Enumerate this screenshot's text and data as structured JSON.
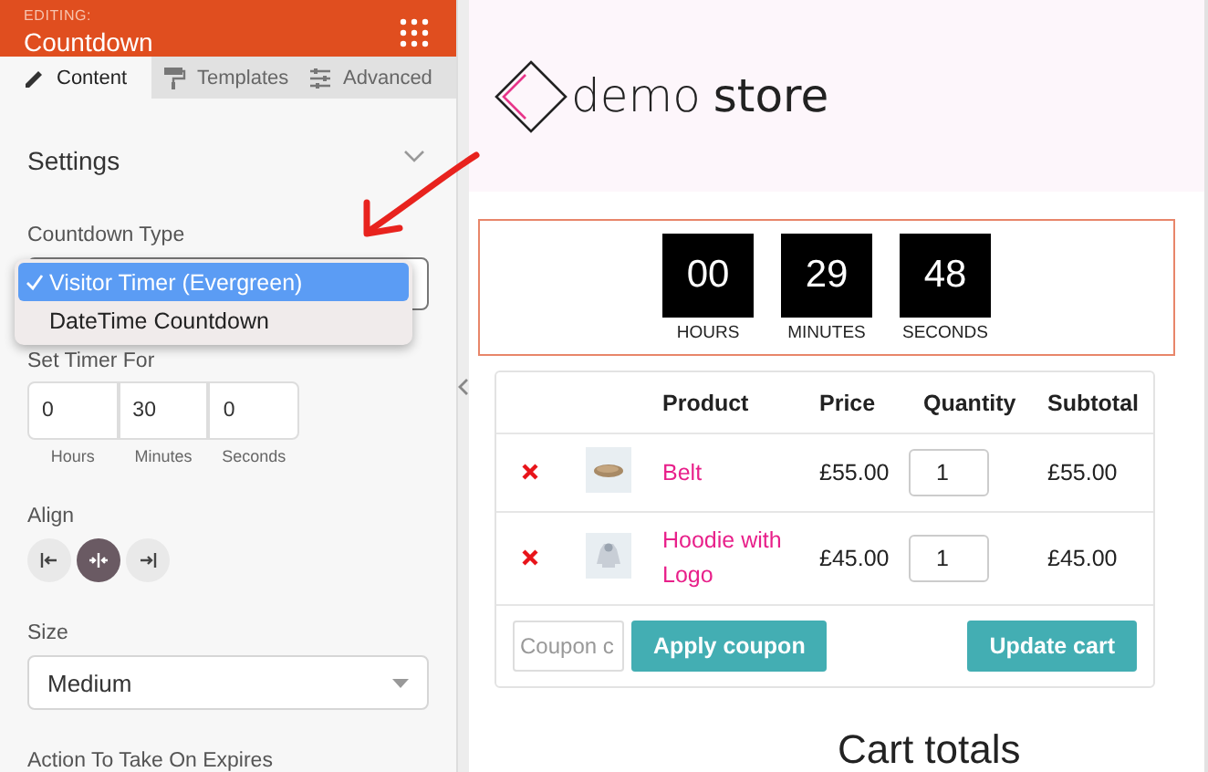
{
  "sidebar": {
    "editing_label": "EDITING:",
    "title": "Countdown",
    "tabs": [
      {
        "label": "Content",
        "kind": "pencil",
        "selected": true
      },
      {
        "label": "Templates",
        "kind": "roller",
        "selected": false
      },
      {
        "label": "Advanced",
        "kind": "sliders",
        "selected": false
      }
    ],
    "section": {
      "title": "Settings",
      "expanded": true
    },
    "countdown_type": {
      "label": "Countdown Type",
      "options": [
        {
          "label": "Visitor Timer (Evergreen)",
          "selected": true
        },
        {
          "label": "DateTime Countdown",
          "selected": false
        }
      ]
    },
    "timer": {
      "label": "Set Timer For",
      "fields": [
        {
          "value": "0",
          "label": "Hours"
        },
        {
          "value": "30",
          "label": "Minutes"
        },
        {
          "value": "0",
          "label": "Seconds"
        }
      ]
    },
    "align": {
      "label": "Align",
      "options": [
        {
          "kind": "left",
          "selected": false
        },
        {
          "kind": "center",
          "selected": true
        },
        {
          "kind": "right",
          "selected": false
        }
      ]
    },
    "size": {
      "label": "Size",
      "value": "Medium"
    },
    "expires_label": "Action To Take On Expires"
  },
  "preview": {
    "logo": {
      "word_1": "demo",
      "word_2": "store"
    },
    "countdown": [
      {
        "value": "00",
        "unit": "HOURS"
      },
      {
        "value": "29",
        "unit": "MINUTES"
      },
      {
        "value": "48",
        "unit": "SECONDS"
      }
    ],
    "cart": {
      "columns": [
        "Product",
        "Price",
        "Quantity",
        "Subtotal"
      ],
      "rows": [
        {
          "kind": "belt",
          "product": "Belt",
          "price": "£55.00",
          "quantity": "1",
          "subtotal": "£55.00"
        },
        {
          "kind": "hoodie",
          "product": "Hoodie with Logo",
          "price": "£45.00",
          "quantity": "1",
          "subtotal": "£45.00"
        }
      ],
      "coupon_placeholder": "Coupon c",
      "apply_button": "Apply coupon",
      "update_button": "Update cart"
    },
    "totals_title": "Cart totals"
  }
}
